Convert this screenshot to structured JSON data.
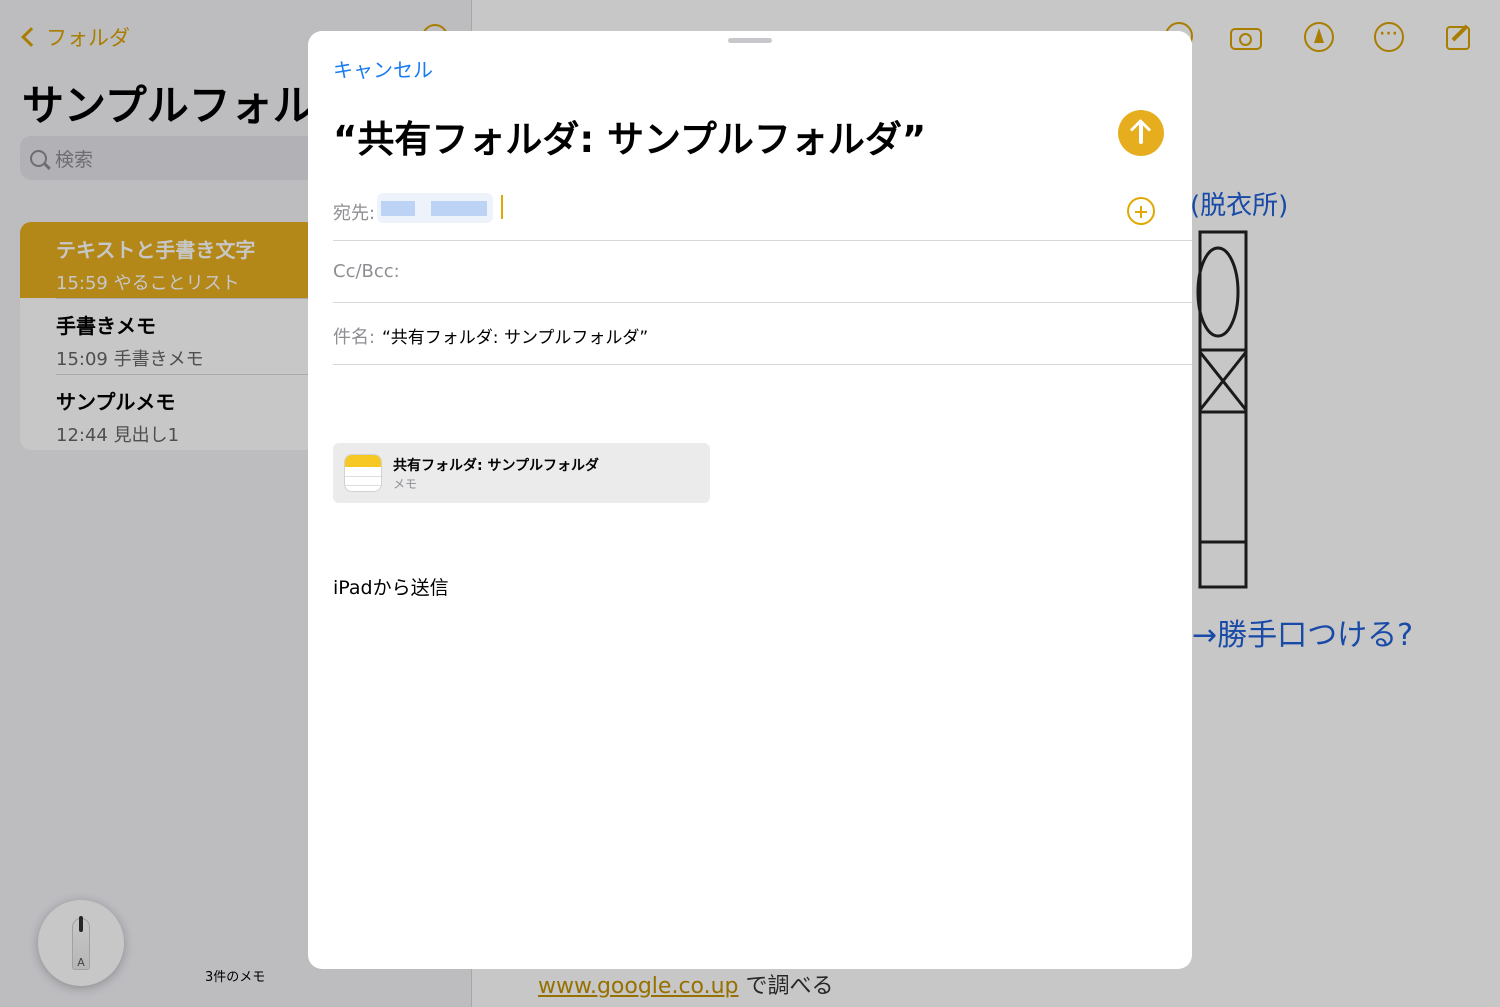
{
  "sidebar": {
    "back_label": "フォルダ",
    "folder_title": "サンプルフォルダ",
    "search_placeholder": "検索",
    "notes": [
      {
        "title": "テキストと手書き文字",
        "time": "15:59",
        "preview": "やることリスト",
        "selected": true
      },
      {
        "title": "手書きメモ",
        "time": "15:09",
        "preview": "手書きメモ",
        "selected": false
      },
      {
        "title": "サンプルメモ",
        "time": "12:44",
        "preview": "見出し1",
        "selected": false
      }
    ],
    "note_count": "3件のメモ"
  },
  "content": {
    "google_link": "www.google.co.up",
    "google_suffix": "で調べる",
    "handwriting": {
      "label_top": "(脱衣所)",
      "label_bottom": "→勝手口つける?"
    }
  },
  "pencil_palette": {
    "letter": "A"
  },
  "compose": {
    "cancel_label": "キャンセル",
    "title": "“共有フォルダ: サンプルフォルダ”",
    "to_label": "宛先:",
    "ccbcc_label": "Cc/Bcc:",
    "subject_label": "件名:",
    "subject_value": "“共有フォルダ: サンプルフォルダ”",
    "attachment": {
      "title": "共有フォルダ: サンプルフォルダ",
      "subtitle": "メモ"
    },
    "signature": "iPadから送信"
  },
  "colors": {
    "accent": "#e6ae1f",
    "link": "#1a7cf0"
  },
  "icons": [
    "chevron-left-icon",
    "search-icon",
    "camera-icon",
    "markup-icon",
    "more-icon",
    "compose-icon",
    "send-arrow-icon",
    "add-contact-icon",
    "notes-app-icon",
    "pencil-icon"
  ]
}
